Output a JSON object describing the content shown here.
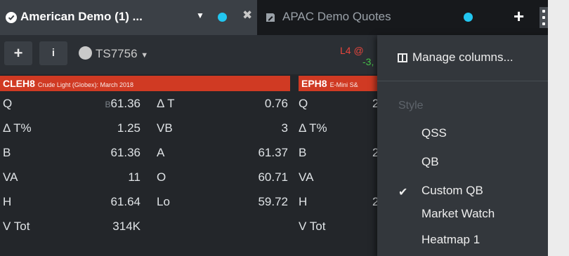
{
  "tabs": [
    {
      "label": "American Demo (1) ...",
      "active": true,
      "indicator_color": "#22c6f0"
    },
    {
      "label": "APAC Demo Quotes",
      "active": false,
      "indicator_color": "#22c6f0"
    }
  ],
  "add_tab_label": "+",
  "toolbar": {
    "add_label": "+",
    "info_label": "i",
    "account": "TS7756",
    "alert_line1": "L4 @",
    "alert_line2": "-3,"
  },
  "panels": [
    {
      "symbol": "CLEH8",
      "description": "Crude Light (Globex): March 2018",
      "rows": [
        {
          "l1": "Q",
          "v1_prefix": "B",
          "v1": "61.36",
          "l2": "Δ T",
          "v2": "0.76"
        },
        {
          "l1": "Δ T%",
          "v1": "1.25",
          "l2": "VB",
          "v2": "3"
        },
        {
          "l1": "B",
          "v1": "61.36",
          "l2": "A",
          "v2": "61.37"
        },
        {
          "l1": "VA",
          "v1": "11",
          "l2": "O",
          "v2": "60.71"
        },
        {
          "l1": "H",
          "v1": "61.64",
          "l2": "Lo",
          "v2": "59.72"
        },
        {
          "l1": "V Tot",
          "v1": "314K"
        }
      ]
    },
    {
      "symbol": "EPH8",
      "description": "E-Mini S&",
      "rows": [
        {
          "l1": "Q",
          "v1": "2"
        },
        {
          "l1": "Δ T%"
        },
        {
          "l1": "B",
          "v1": "2"
        },
        {
          "l1": "VA"
        },
        {
          "l1": "H",
          "v1": "2"
        },
        {
          "l1": "V Tot"
        }
      ]
    }
  ],
  "menu": {
    "manage_columns": "Manage columns...",
    "section_label": "Style",
    "items": [
      {
        "label": "QSS",
        "checked": false
      },
      {
        "label": "QB",
        "checked": false
      },
      {
        "label": "Custom QB",
        "checked": true
      },
      {
        "label": "Market Watch",
        "checked": false
      },
      {
        "label": "Heatmap 1",
        "checked": false
      }
    ]
  },
  "colors": {
    "accent_dot": "#22c6f0",
    "header_red": "#d03a23",
    "alert_red": "#e8453c",
    "alert_green": "#46c34a"
  }
}
